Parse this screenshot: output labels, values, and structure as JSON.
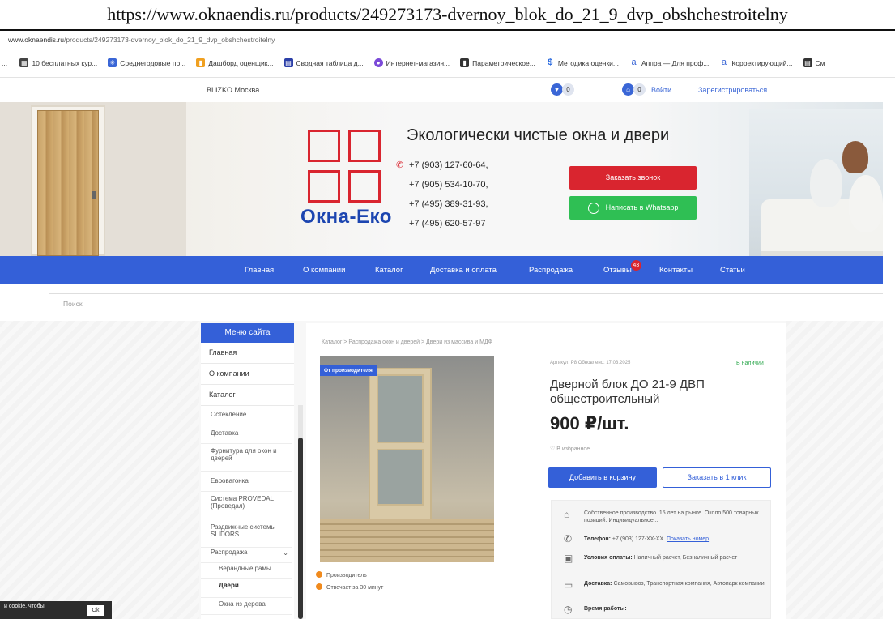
{
  "caption": "https://www.oknaendis.ru/products/249273173-dvernoy_blok_do_21_9_dvp_obshchestroitelny",
  "address_bar": {
    "domain": "www.oknaendis.ru",
    "path": "/products/249273173-dvernoy_blok_do_21_9_dvp_obshchestroitelny"
  },
  "bookmarks": [
    {
      "label": "10 бесплатных кур...",
      "icon": "grid-icon",
      "color": "#444444"
    },
    {
      "label": "Среднегодовые пр...",
      "icon": "flower-icon",
      "color": "#3a66d6"
    },
    {
      "label": "Дашборд оценщик...",
      "icon": "chart-icon",
      "color": "#f0a020"
    },
    {
      "label": "Сводная таблица д...",
      "icon": "doc-icon",
      "color": "#2b3fa8"
    },
    {
      "label": "Интернет-магазин...",
      "icon": "shop-icon",
      "color": "#7b4ad8"
    },
    {
      "label": "Параметрическое...",
      "icon": "file-icon",
      "color": "#333333"
    },
    {
      "label": "Методика оценки...",
      "icon": "dollar-icon",
      "color": "#2b6be0"
    },
    {
      "label": "Аппра — Для проф...",
      "icon": "a-icon",
      "color": "#3a66d6"
    },
    {
      "label": "Корректирующий...",
      "icon": "a-icon",
      "color": "#3a66d6"
    },
    {
      "label": "См",
      "icon": "doc-icon",
      "color": "#333333"
    }
  ],
  "topbar": {
    "city": "BLIZKO Москва",
    "favorites_count": "0",
    "cart_count": "0",
    "login": "Войти",
    "register": "Зарегистрироваться"
  },
  "banner": {
    "slogan": "Экологически чистые окна и двери",
    "logo_text": "Окна-Еко",
    "phones": [
      "+7 (903) 127-60-64,",
      "+7 (905) 534-10-70,",
      "+7 (495) 389-31-93,",
      "+7 (495) 620-57-97"
    ],
    "call_button": "Заказать звонок",
    "whatsapp_button": "Написать в Whatsapp",
    "colors": {
      "red": "#d9252f",
      "green": "#2fbf54",
      "blue": "#1c45b0"
    }
  },
  "nav": {
    "items": [
      "Главная",
      "О компании",
      "Каталог",
      "Доставка и оплата",
      "Распродажа",
      "Отзывы",
      "Контакты",
      "Статьи"
    ],
    "reviews_badge": "43"
  },
  "search": {
    "placeholder": "Поиск"
  },
  "sidebar": {
    "header": "Меню сайта",
    "items": [
      "Главная",
      "О компании",
      "Каталог"
    ],
    "subitems": [
      "Остекление",
      "Доставка",
      "Фурнитура для окон и дверей",
      "Евровагонка",
      "Система PROVEDAL (Проведал)",
      "Раздвижные системы SLIDORS",
      "Распродажа"
    ],
    "sale_subitems": [
      "Верандные рамы",
      "Двери",
      "Окна из дерева"
    ]
  },
  "product": {
    "breadcrumb": "Каталог  >  Распродажа окон и дверей  >  Двери из массива и МДФ",
    "label": "От производителя",
    "article": "Артикул: Р8   Обновлено: 17.03.2025",
    "in_stock": "В наличии",
    "title": "Дверной блок ДО 21-9 ДВП общестроительный",
    "price": "900 ₽/шт.",
    "favorite": "В избранное",
    "add_to_cart": "Добавить в корзину",
    "one_click": "Заказать в 1 клик",
    "features": [
      "Производитель",
      "Отвечает за 30 минут"
    ],
    "info": {
      "about": "Собственное производство. 15 лет на рынке. Около 500 товарных позиций. Индивидуальное...",
      "phone_label": "Телефон:",
      "phone_value": "+7 (903) 127-XX-XX",
      "phone_show": "Показать номер",
      "payment_label": "Условия оплаты:",
      "payment_value": "Наличный расчет, Безналичный расчет",
      "delivery_label": "Доставка:",
      "delivery_value": "Самовывоз, Транспортная компания, Автопарк компании",
      "hours_label": "Время работы:"
    }
  },
  "cookie": {
    "text": "и cookie, чтобы",
    "ok": "Ok"
  }
}
